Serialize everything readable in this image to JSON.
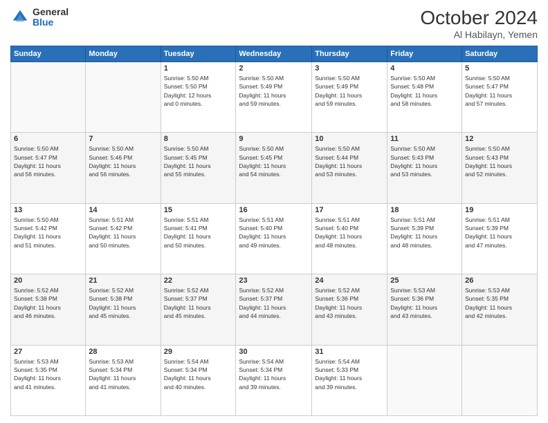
{
  "logo": {
    "general": "General",
    "blue": "Blue"
  },
  "header": {
    "month": "October 2024",
    "location": "Al Habilayn, Yemen"
  },
  "weekdays": [
    "Sunday",
    "Monday",
    "Tuesday",
    "Wednesday",
    "Thursday",
    "Friday",
    "Saturday"
  ],
  "weeks": [
    [
      {
        "day": "",
        "info": ""
      },
      {
        "day": "",
        "info": ""
      },
      {
        "day": "1",
        "info": "Sunrise: 5:50 AM\nSunset: 5:50 PM\nDaylight: 12 hours\nand 0 minutes."
      },
      {
        "day": "2",
        "info": "Sunrise: 5:50 AM\nSunset: 5:49 PM\nDaylight: 11 hours\nand 59 minutes."
      },
      {
        "day": "3",
        "info": "Sunrise: 5:50 AM\nSunset: 5:49 PM\nDaylight: 11 hours\nand 59 minutes."
      },
      {
        "day": "4",
        "info": "Sunrise: 5:50 AM\nSunset: 5:48 PM\nDaylight: 11 hours\nand 58 minutes."
      },
      {
        "day": "5",
        "info": "Sunrise: 5:50 AM\nSunset: 5:47 PM\nDaylight: 11 hours\nand 57 minutes."
      }
    ],
    [
      {
        "day": "6",
        "info": "Sunrise: 5:50 AM\nSunset: 5:47 PM\nDaylight: 11 hours\nand 56 minutes."
      },
      {
        "day": "7",
        "info": "Sunrise: 5:50 AM\nSunset: 5:46 PM\nDaylight: 11 hours\nand 56 minutes."
      },
      {
        "day": "8",
        "info": "Sunrise: 5:50 AM\nSunset: 5:45 PM\nDaylight: 11 hours\nand 55 minutes."
      },
      {
        "day": "9",
        "info": "Sunrise: 5:50 AM\nSunset: 5:45 PM\nDaylight: 11 hours\nand 54 minutes."
      },
      {
        "day": "10",
        "info": "Sunrise: 5:50 AM\nSunset: 5:44 PM\nDaylight: 11 hours\nand 53 minutes."
      },
      {
        "day": "11",
        "info": "Sunrise: 5:50 AM\nSunset: 5:43 PM\nDaylight: 11 hours\nand 53 minutes."
      },
      {
        "day": "12",
        "info": "Sunrise: 5:50 AM\nSunset: 5:43 PM\nDaylight: 11 hours\nand 52 minutes."
      }
    ],
    [
      {
        "day": "13",
        "info": "Sunrise: 5:50 AM\nSunset: 5:42 PM\nDaylight: 11 hours\nand 51 minutes."
      },
      {
        "day": "14",
        "info": "Sunrise: 5:51 AM\nSunset: 5:42 PM\nDaylight: 11 hours\nand 50 minutes."
      },
      {
        "day": "15",
        "info": "Sunrise: 5:51 AM\nSunset: 5:41 PM\nDaylight: 11 hours\nand 50 minutes."
      },
      {
        "day": "16",
        "info": "Sunrise: 5:51 AM\nSunset: 5:40 PM\nDaylight: 11 hours\nand 49 minutes."
      },
      {
        "day": "17",
        "info": "Sunrise: 5:51 AM\nSunset: 5:40 PM\nDaylight: 11 hours\nand 48 minutes."
      },
      {
        "day": "18",
        "info": "Sunrise: 5:51 AM\nSunset: 5:39 PM\nDaylight: 11 hours\nand 48 minutes."
      },
      {
        "day": "19",
        "info": "Sunrise: 5:51 AM\nSunset: 5:39 PM\nDaylight: 11 hours\nand 47 minutes."
      }
    ],
    [
      {
        "day": "20",
        "info": "Sunrise: 5:52 AM\nSunset: 5:38 PM\nDaylight: 11 hours\nand 46 minutes."
      },
      {
        "day": "21",
        "info": "Sunrise: 5:52 AM\nSunset: 5:38 PM\nDaylight: 11 hours\nand 45 minutes."
      },
      {
        "day": "22",
        "info": "Sunrise: 5:52 AM\nSunset: 5:37 PM\nDaylight: 11 hours\nand 45 minutes."
      },
      {
        "day": "23",
        "info": "Sunrise: 5:52 AM\nSunset: 5:37 PM\nDaylight: 11 hours\nand 44 minutes."
      },
      {
        "day": "24",
        "info": "Sunrise: 5:52 AM\nSunset: 5:36 PM\nDaylight: 11 hours\nand 43 minutes."
      },
      {
        "day": "25",
        "info": "Sunrise: 5:53 AM\nSunset: 5:36 PM\nDaylight: 11 hours\nand 43 minutes."
      },
      {
        "day": "26",
        "info": "Sunrise: 5:53 AM\nSunset: 5:35 PM\nDaylight: 11 hours\nand 42 minutes."
      }
    ],
    [
      {
        "day": "27",
        "info": "Sunrise: 5:53 AM\nSunset: 5:35 PM\nDaylight: 11 hours\nand 41 minutes."
      },
      {
        "day": "28",
        "info": "Sunrise: 5:53 AM\nSunset: 5:34 PM\nDaylight: 11 hours\nand 41 minutes."
      },
      {
        "day": "29",
        "info": "Sunrise: 5:54 AM\nSunset: 5:34 PM\nDaylight: 11 hours\nand 40 minutes."
      },
      {
        "day": "30",
        "info": "Sunrise: 5:54 AM\nSunset: 5:34 PM\nDaylight: 11 hours\nand 39 minutes."
      },
      {
        "day": "31",
        "info": "Sunrise: 5:54 AM\nSunset: 5:33 PM\nDaylight: 11 hours\nand 39 minutes."
      },
      {
        "day": "",
        "info": ""
      },
      {
        "day": "",
        "info": ""
      }
    ]
  ]
}
